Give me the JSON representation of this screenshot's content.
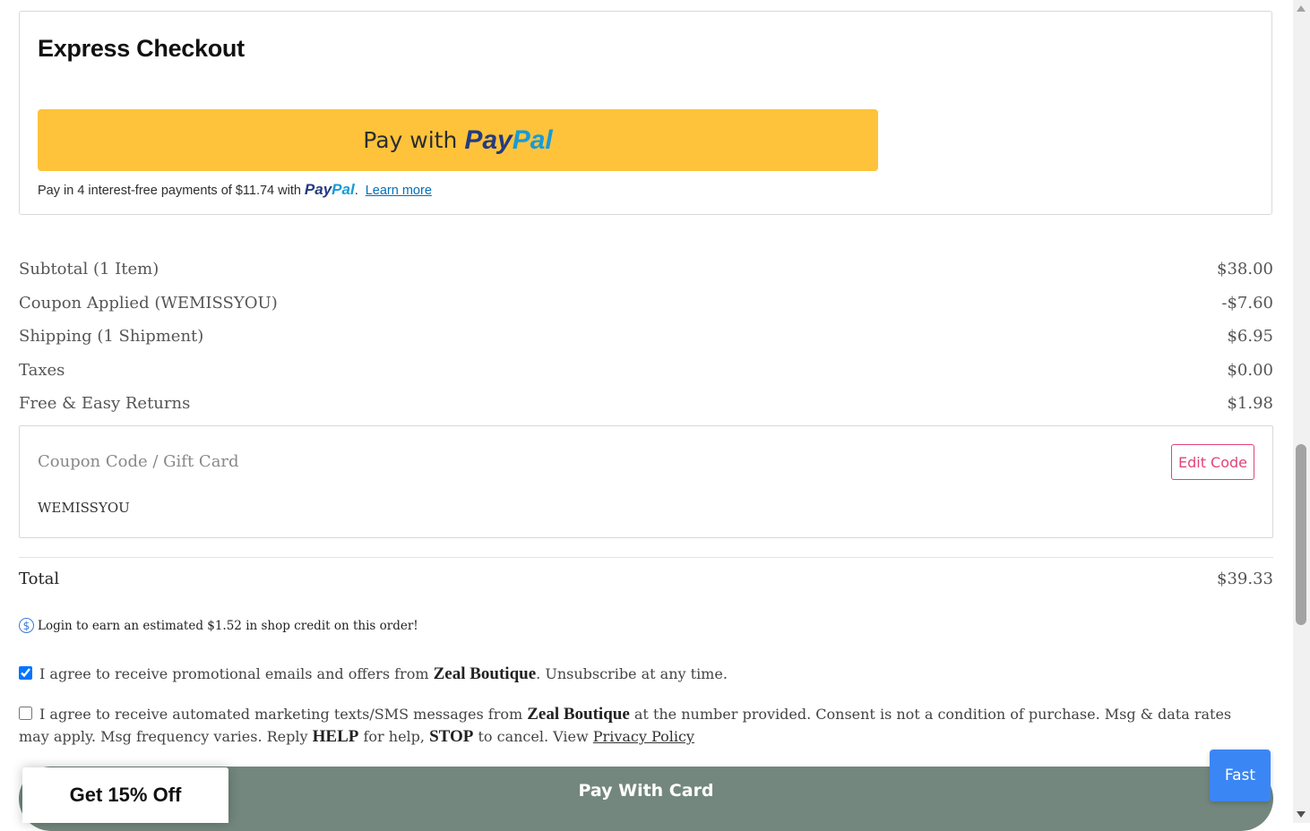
{
  "express": {
    "title": "Express Checkout",
    "paypal_button": {
      "prefix": "Pay with",
      "brand_part1": "Pay",
      "brand_part2": "Pal"
    },
    "paylater": {
      "text": "Pay in 4 interest-free payments of $11.74 with",
      "brand_part1": "Pay",
      "brand_part2": "Pal",
      "period": ".",
      "link": "Learn more"
    }
  },
  "summary": [
    {
      "label": "Subtotal (1 Item)",
      "value": "$38.00"
    },
    {
      "label": "Coupon Applied (WEMISSYOU)",
      "value": "-$7.60"
    },
    {
      "label": "Shipping (1 Shipment)",
      "value": "$6.95"
    },
    {
      "label": "Taxes",
      "value": "$0.00"
    },
    {
      "label": "Free & Easy Returns",
      "value": "$1.98"
    }
  ],
  "coupon": {
    "label": "Coupon Code / Gift Card",
    "code": "WEMISSYOU",
    "edit_label": "Edit Code"
  },
  "total": {
    "label": "Total",
    "value": "$39.33"
  },
  "credit": {
    "icon": "dollar-circle-icon",
    "text": "Login to earn an estimated $1.52 in shop credit on this order!"
  },
  "consent_email": {
    "checked": true,
    "text_before": "I agree to receive promotional emails and offers from",
    "brand": "Zeal Boutique",
    "text_after": ". Unsubscribe at any time."
  },
  "consent_sms": {
    "checked": false,
    "text_before": "I agree to receive automated marketing texts/SMS messages from",
    "brand": "Zeal Boutique",
    "text_mid": "at the number provided. Consent is not a condition of purchase. Msg & data rates may apply. Msg frequency varies. Reply",
    "help": "HELP",
    "text_mid2": "for help,",
    "stop": "STOP",
    "text_mid3": "to cancel. View",
    "policy_link": "Privacy Policy"
  },
  "pay_card_label": "Pay With Card",
  "discount_tab_label": "Get 15% Off",
  "fast_label": "Fast",
  "colors": {
    "paypal_yellow": "#fec33b",
    "accent_pink": "#e0457b",
    "pay_card_green": "#73877e",
    "fast_blue": "#3b86f5"
  }
}
